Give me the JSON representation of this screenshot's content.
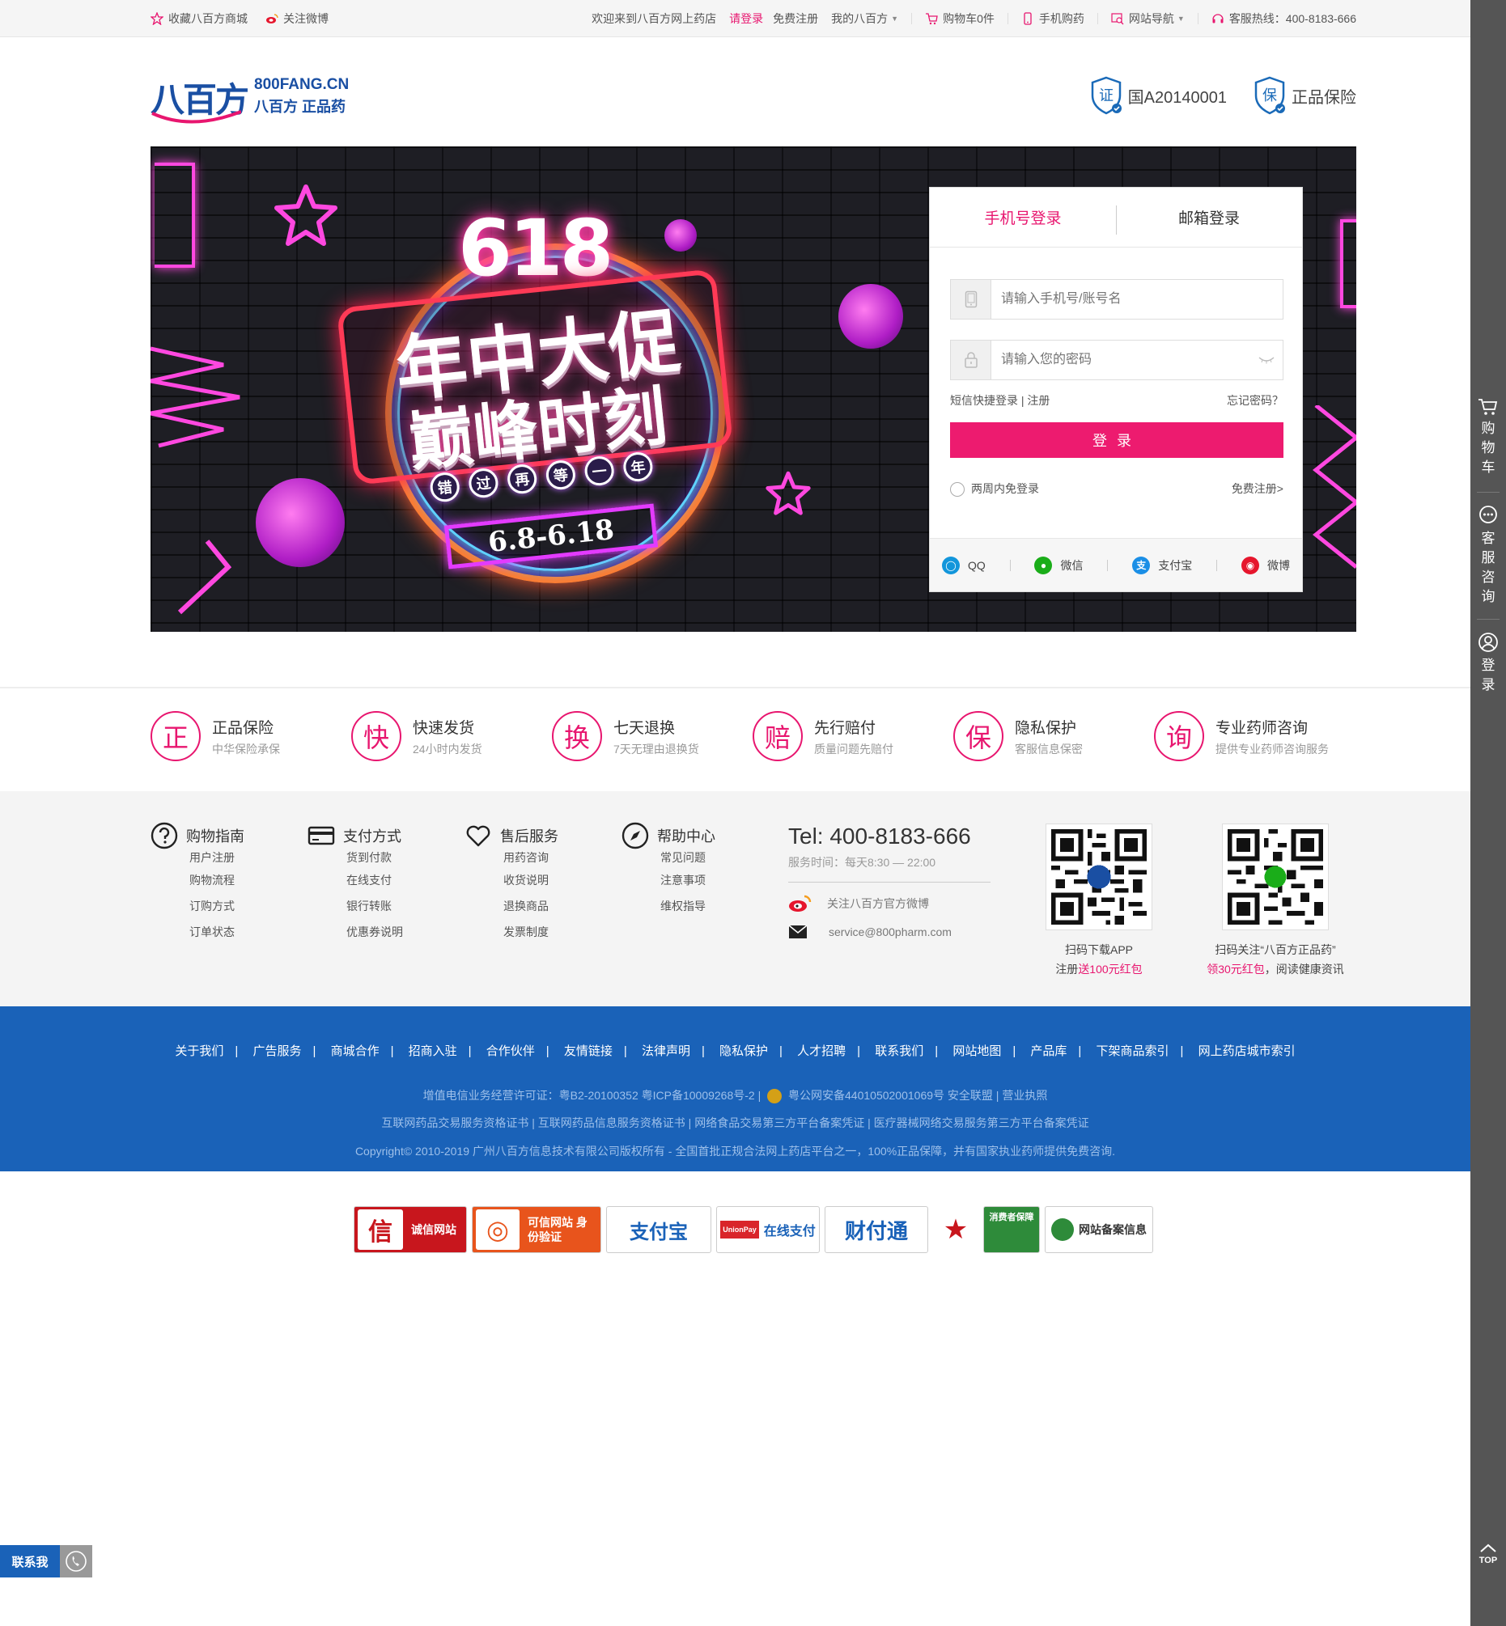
{
  "topbar": {
    "favorite": "收藏八百方商城",
    "weibo": "关注微博",
    "welcome": "欢迎来到八百方网上药店",
    "login": "请登录",
    "register": "免费注册",
    "my_account": "我的八百方",
    "cart": "购物车0件",
    "mobile": "手机购药",
    "site_nav": "网站导航",
    "hotline": "客服热线：400-8183-666"
  },
  "header": {
    "logo_cn_big": "八百方",
    "logo_en": "800FANG.CN",
    "logo_sub": "八百方 正品药",
    "badge_license": "国A20140001",
    "badge_insurance": "正品保险",
    "badge_license_glyph": "证",
    "badge_insurance_glyph": "保"
  },
  "banner": {
    "num": "618",
    "title1": "年中大促",
    "title2": "巅峰时刻",
    "chips": [
      "错",
      "过",
      "再",
      "等",
      "一",
      "年"
    ],
    "date": "6.8-6.18"
  },
  "login": {
    "tab_phone": "手机号登录",
    "tab_email": "邮箱登录",
    "account_placeholder": "请输入手机号/账号名",
    "password_placeholder": "请输入您的密码",
    "sms_login": "短信快捷登录 | 注册",
    "forgot": "忘记密码？",
    "submit": "登录",
    "remember": "两周内免登录",
    "free_register": "免费注册>",
    "social": {
      "qq": "QQ",
      "wechat": "微信",
      "alipay": "支付宝",
      "weibo": "微博"
    }
  },
  "features": [
    {
      "glyph": "正",
      "title": "正品保险",
      "sub": "中华保险承保"
    },
    {
      "glyph": "快",
      "title": "快速发货",
      "sub": "24小时内发货"
    },
    {
      "glyph": "换",
      "title": "七天退换",
      "sub": "7天无理由退换货"
    },
    {
      "glyph": "赔",
      "title": "先行赔付",
      "sub": "质量问题先赔付"
    },
    {
      "glyph": "保",
      "title": "隐私保护",
      "sub": "客服信息保密"
    },
    {
      "glyph": "询",
      "title": "专业药师咨询",
      "sub": "提供专业药师咨询服务"
    }
  ],
  "help": {
    "cols": [
      {
        "title": "购物指南",
        "items": [
          "用户注册",
          "购物流程",
          "订购方式",
          "订单状态"
        ]
      },
      {
        "title": "支付方式",
        "items": [
          "货到付款",
          "在线支付",
          "银行转账",
          "优惠券说明"
        ]
      },
      {
        "title": "售后服务",
        "items": [
          "用药咨询",
          "收货说明",
          "退换商品",
          "发票制度"
        ]
      },
      {
        "title": "帮助中心",
        "items": [
          "常见问题",
          "注意事项",
          "维权指导"
        ]
      }
    ],
    "tel": "Tel: 400-8183-666",
    "hours": "服务时间：每天8:30 — 22:00",
    "weibo": "关注八百方官方微博",
    "email": "service@800pharm.com",
    "qr1_line1": "扫码下载APP",
    "qr1_line2_a": "注册",
    "qr1_line2_b": "送100元红包",
    "qr2_line1": "扫码关注“八百方正品药”",
    "qr2_line2_a": "领30元红包",
    "qr2_line2_b": "，阅读健康资讯"
  },
  "footer": {
    "nav": [
      "关于我们",
      "广告服务",
      "商城合作",
      "招商入驻",
      "合作伙伴",
      "友情链接",
      "法律声明",
      "隐私保护",
      "人才招聘",
      "联系我们",
      "网站地图",
      "产品库",
      "下架商品索引",
      "网上药店城市索引"
    ],
    "legal1": "增值电信业务经营许可证：粤B2-20100352   粤ICP备10009268号-2 |",
    "legal1b": "粤公网安备44010502001069号   安全联盟 |  营业执照",
    "legal2": "互联网药品交易服务资格证书 |  互联网药品信息服务资格证书 |  网络食品交易第三方平台备案凭证 |  医疗器械网络交易服务第三方平台备案凭证",
    "legal3": "Copyright© 2010-2019 广州八百方信息技术有限公司版权所有 - 全国首批正规合法网上药店平台之一，100%正品保障，并有国家执业药师提供免费咨询."
  },
  "trust": [
    {
      "label": "诚信网站",
      "mark": "信",
      "color": "#d9252a"
    },
    {
      "label": "可信网站 身份验证",
      "mark": "◎",
      "color": "#e8541c"
    },
    {
      "label": "支付宝",
      "mark": "",
      "color": "#1a62b8"
    },
    {
      "label": "在线支付",
      "mark": "UnionPay",
      "color": "#1a62b8"
    },
    {
      "label": "财付通",
      "mark": "",
      "color": "#1a62b8"
    },
    {
      "label": "",
      "mark": "★",
      "color": "#c8161d"
    },
    {
      "label": "消费者保障",
      "mark": "",
      "color": "#2e8b3a"
    },
    {
      "label": "网站备案信息",
      "mark": "",
      "color": "#2e8b3a"
    }
  ],
  "sidebar": {
    "cart": "购物车",
    "service": "客服咨询",
    "login": "登录",
    "top": "TOP"
  },
  "contact_me": "联系我",
  "colors": {
    "accent": "#e8166f",
    "footer_blue": "#1a62b8",
    "login_button": "#ed1b6f"
  }
}
